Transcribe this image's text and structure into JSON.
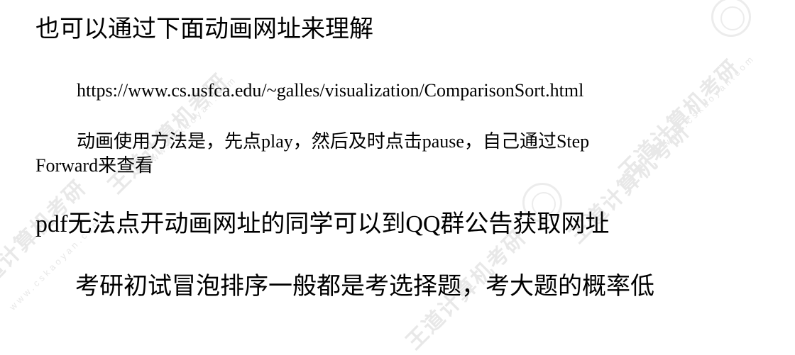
{
  "lines": {
    "heading1": "也可以通过下面动画网址来理解",
    "url": "https://www.cs.usfca.edu/~galles/visualization/ComparisonSort.html",
    "usage_line1": "动画使用方法是，先点play，然后及时点击pause，自己通过Step",
    "usage_line2": "Forward来查看",
    "heading2": "pdf无法点开动画网址的同学可以到QQ群公告获取网址",
    "heading3": "考研初试冒泡排序一般都是考选择题，考大题的概率低"
  },
  "watermark": {
    "text": "王道计算机考研",
    "sub": "www.cskaoyan.com"
  }
}
